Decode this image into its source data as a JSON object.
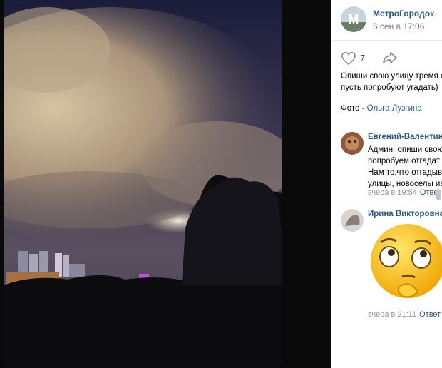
{
  "post": {
    "group_name": "МетроГородок",
    "date": "6 сен в 17:06",
    "likes": "7",
    "text_line1": "Опиши свою улицу тремя с",
    "text_line2": "пусть попробуют угадать)",
    "credit_prefix": "Фото - ",
    "credit_author": "Ольга Лузгина"
  },
  "comments": [
    {
      "author": "Евгений-Валентинов",
      "lines": [
        "Админ! опиши свою",
        "попробуем отгадат",
        "Нам то,что отгадыв",
        "улицы, новоселы из"
      ],
      "time": "вчера в 19:54",
      "reply": "Ответ"
    },
    {
      "author": "Ирина Викторовна",
      "sticker": "thinking-face-sticker",
      "time": "вчера в 21:11",
      "reply": "Ответ"
    }
  ],
  "colors": {
    "link": "#2a5885",
    "meta": "#828282",
    "background": "#0a0a0a"
  }
}
